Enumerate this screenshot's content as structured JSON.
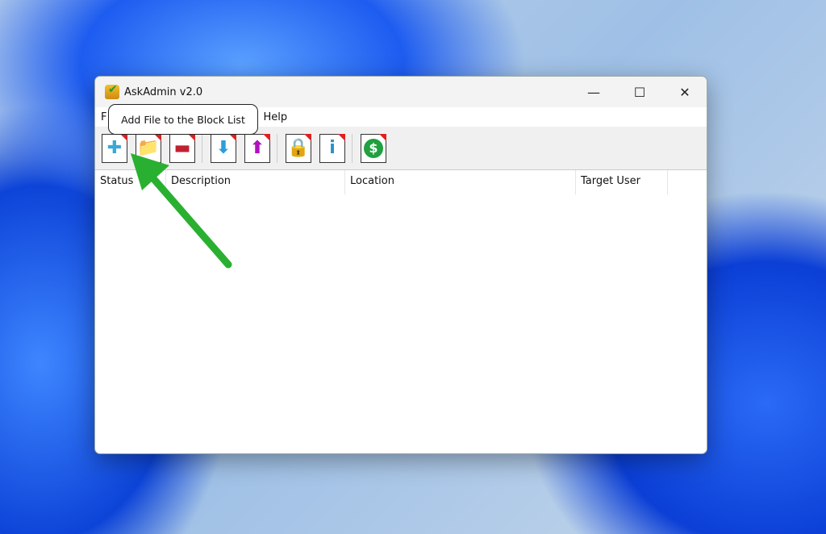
{
  "window": {
    "title": "AskAdmin v2.0",
    "minimize": "—",
    "maximize": "☐",
    "close": "✕"
  },
  "menu": [
    {
      "label": "F"
    },
    {
      "label": "Help"
    }
  ],
  "tooltip": "Add File to the Block List",
  "toolbar": [
    {
      "icon": "add-file-icon",
      "glyph": "✚",
      "color": "#3aa8d8"
    },
    {
      "icon": "add-folder-icon",
      "glyph": "📁",
      "color": "#e8a020"
    },
    {
      "icon": "remove-icon",
      "glyph": "▬",
      "color": "#c02030"
    },
    {
      "icon": "import-down-arrow-icon",
      "glyph": "⬇",
      "color": "#2aa0d8"
    },
    {
      "icon": "export-up-arrow-icon",
      "glyph": "⬆",
      "color": "#b010c0"
    },
    {
      "icon": "lock-icon",
      "glyph": "🔒",
      "color": "#e0a020"
    },
    {
      "icon": "info-icon",
      "glyph": "i",
      "color": "#2a90c8"
    },
    {
      "icon": "donate-dollar-icon",
      "glyph": "$",
      "color": "#20a040"
    }
  ],
  "columns": [
    "Status",
    "Description",
    "Location",
    "Target User"
  ],
  "annotation_color": "#2ab030"
}
